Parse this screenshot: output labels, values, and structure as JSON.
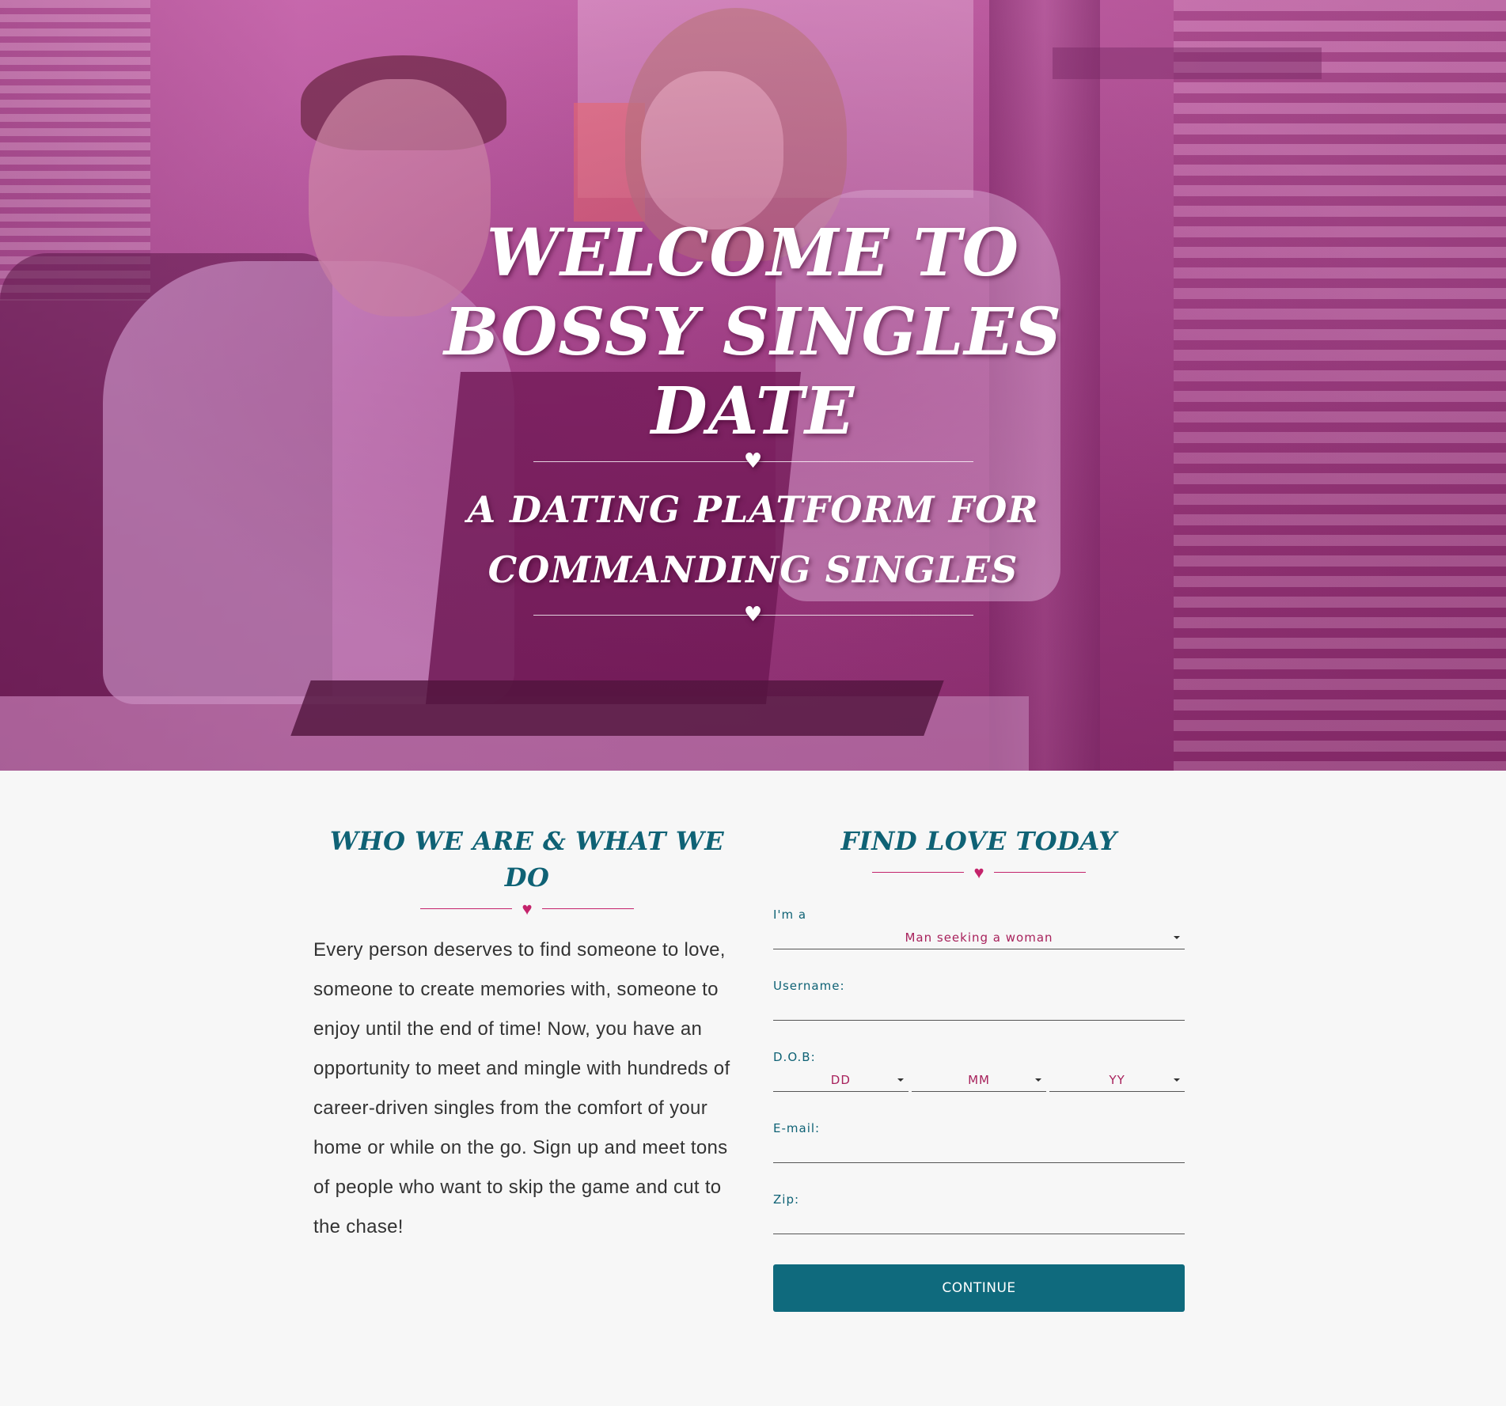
{
  "hero": {
    "title": "WELCOME TO BOSSY SINGLES DATE",
    "subtitle": "A DATING PLATFORM FOR COMMANDING SINGLES",
    "divider_icon": "heart-icon"
  },
  "about": {
    "title": "WHO WE ARE & WHAT WE DO",
    "text": "Every person deserves to find someone to love, someone to create memories with, someone to enjoy until the end of time! Now, you have an opportunity to meet and mingle with hundreds of career-driven singles from the comfort of your home or while on the go. Sign up and meet tons of people who want to skip the game and cut to the chase!"
  },
  "signup": {
    "title": "FIND LOVE TODAY",
    "seeking_label": "I'm a",
    "seeking_value": "Man seeking a woman",
    "username_label": "Username:",
    "username_value": "",
    "dob_label": "D.O.B:",
    "dob_day": "DD",
    "dob_month": "MM",
    "dob_year": "YY",
    "email_label": "E-mail:",
    "email_value": "",
    "zip_label": "Zip:",
    "zip_value": "",
    "continue_label": "CONTINUE"
  },
  "colors": {
    "accent_teal": "#0f6a7d",
    "accent_pink": "#c4236b",
    "hero_tint": "#a34a87"
  }
}
